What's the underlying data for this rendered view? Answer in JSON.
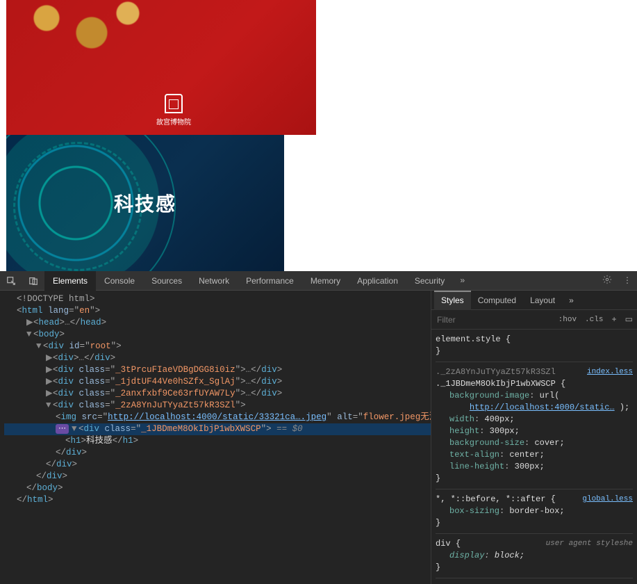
{
  "page": {
    "red_logo_text": "故宫博物院",
    "blue_title": "科技感"
  },
  "devtools": {
    "tabs": [
      "Elements",
      "Console",
      "Sources",
      "Network",
      "Performance",
      "Memory",
      "Application",
      "Security"
    ],
    "active_tab": "Elements",
    "more_glyph": "»",
    "menu_glyph": "⋮",
    "styles_tabs": [
      "Styles",
      "Computed",
      "Layout"
    ],
    "styles_active": "Styles",
    "styles_more": "»",
    "filter_placeholder": "Filter",
    "hov": ":hov",
    "cls": ".cls",
    "plus": "+",
    "dom": {
      "doctype": "<!DOCTYPE html>",
      "html_open": {
        "tag": "html",
        "attr": "lang",
        "val": "en"
      },
      "head": {
        "tag": "head"
      },
      "body": {
        "tag": "body"
      },
      "root": {
        "tag": "div",
        "attr": "id",
        "val": "root"
      },
      "child_div": {
        "tag": "div"
      },
      "c1": {
        "tag": "div",
        "attr": "class",
        "val": "_3tPrcuFIaeVDBgDGG8i0iz"
      },
      "c2": {
        "tag": "div",
        "attr": "class",
        "val": "_1jdtUF44Ve0hSZfx_SglAj"
      },
      "c3": {
        "tag": "div",
        "attr": "class",
        "val": "_2anxfxbf9Ce63rfUYAW7Ly"
      },
      "c4": {
        "tag": "div",
        "attr": "class",
        "val": "_2zA8YnJuTYyaZt57kR3SZl"
      },
      "img": {
        "tag": "img",
        "src": "http://localhost:4000/static/33321ca….jpeg",
        "alt": "flower.jpeg无法显示"
      },
      "sel": {
        "tag": "div",
        "attr": "class",
        "val": "_1JBDmeM8OkIbjP1wbXWSCP",
        "after": " == $0"
      },
      "h1": {
        "tag": "h1",
        "text": "科技感"
      }
    },
    "rules": {
      "r0": {
        "selector": "element.style"
      },
      "r1": {
        "sel_dim": "._2zA8YnJuTYyaZt57kR3SZl",
        "sel": "._1JBDmeM8OkIbjP1wbXWSCP",
        "src": "index.less",
        "props": [
          {
            "n": "background-image",
            "v_pre": "url(",
            "v_url": "http://localhost:4000/static…",
            "v_post": " );"
          },
          {
            "n": "width",
            "v": "400px;"
          },
          {
            "n": "height",
            "v": "300px;"
          },
          {
            "n": "background-size",
            "v": "cover;"
          },
          {
            "n": "text-align",
            "v": "center;"
          },
          {
            "n": "line-height",
            "v": "300px;"
          }
        ]
      },
      "r2": {
        "sel": "*, *::before, *::after",
        "src": "global.less",
        "props": [
          {
            "n": "box-sizing",
            "v": "border-box;"
          }
        ]
      },
      "r3": {
        "sel": "div",
        "src": "user agent styleshe",
        "props": [
          {
            "n": "display",
            "v": "block;"
          }
        ]
      }
    }
  }
}
